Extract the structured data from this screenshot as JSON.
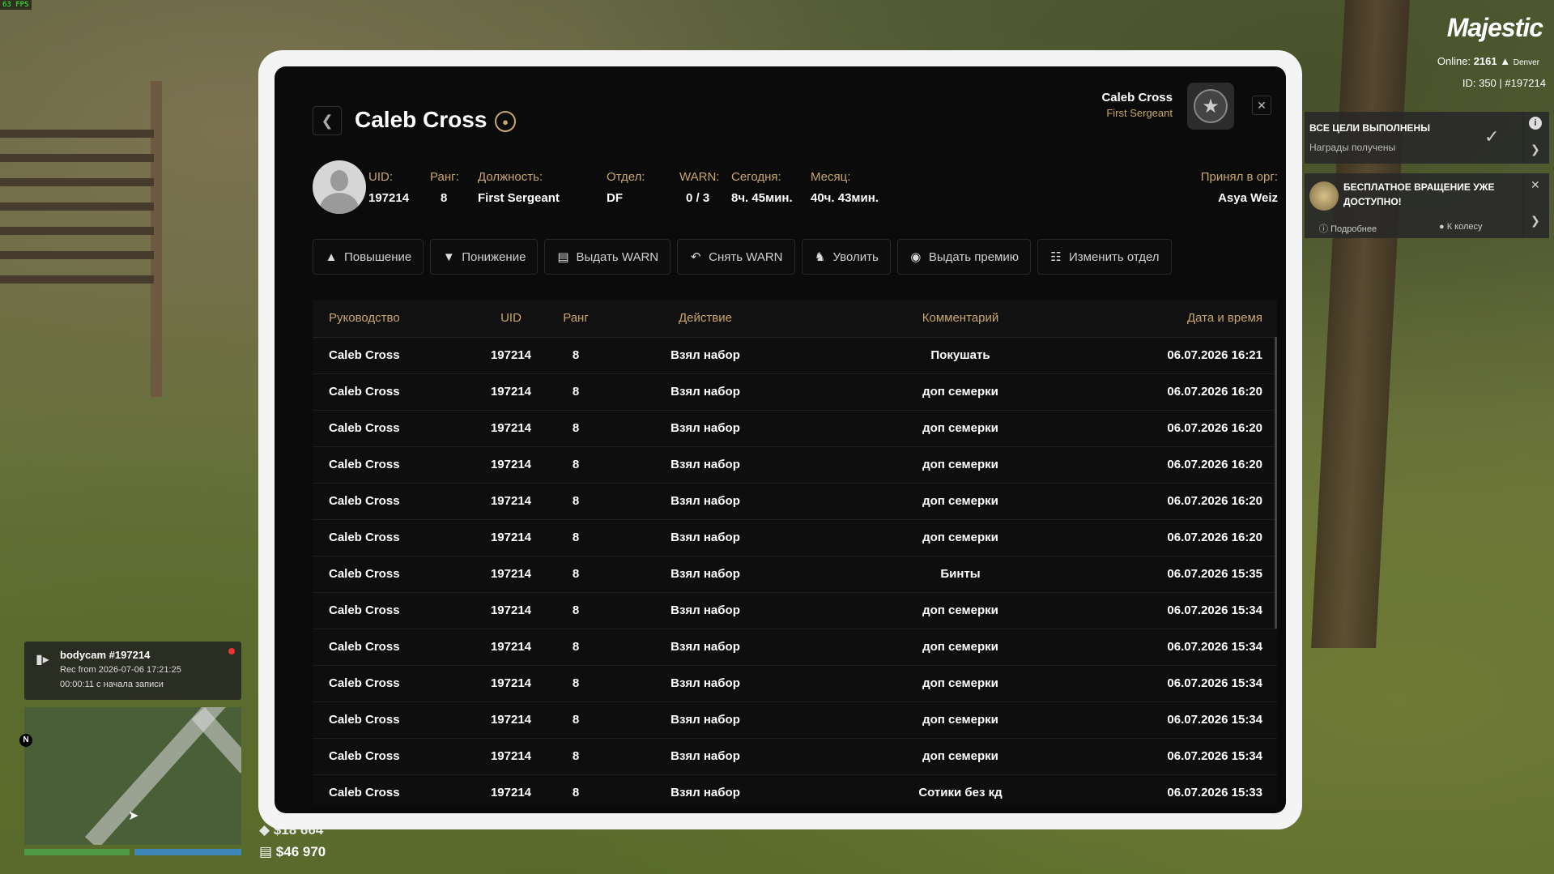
{
  "hud": {
    "fps": "63 FPS",
    "brand": "Majestic",
    "online_label": "Online:",
    "online_count": "2161",
    "server": "Denver",
    "id_line": "ID: 350 | #197214",
    "task_title": "ВСЕ ЦЕЛИ ВЫПОЛНЕНЫ",
    "task_sub": "Награды получены",
    "wheel_text": "БЕСПЛАТНОЕ ВРАЩЕНИЕ УЖЕ ДОСТУПНО!",
    "wheel_more": "Подробнее",
    "wheel_go": "К колесу",
    "bodycam_title": "bodycam #197214",
    "bodycam_rec": "Rec from 2026-07-06 17:21:25",
    "bodycam_time": "00:00:11 с начала записи",
    "compass": "N",
    "cash": "$18 664",
    "bank": "$46 970"
  },
  "tablet": {
    "title": "Caleb Cross",
    "current_user": {
      "name": "Caleb Cross",
      "rank": "First Sergeant"
    },
    "stats": {
      "uid_label": "UID:",
      "uid": "197214",
      "rank_label": "Ранг:",
      "rank": "8",
      "position_label": "Должность:",
      "position": "First Sergeant",
      "dept_label": "Отдел:",
      "dept": "DF",
      "warn_label": "WARN:",
      "warn": "0 / 3",
      "today_label": "Сегодня:",
      "today": "8ч. 45мин.",
      "month_label": "Месяц:",
      "month": "40ч. 43мин.",
      "accepted_label": "Принял в орг:",
      "accepted": "Asya Weiz"
    },
    "actions": [
      {
        "label": "Повышение",
        "icon": "chevron-up-icon"
      },
      {
        "label": "Понижение",
        "icon": "chevron-down-icon"
      },
      {
        "label": "Выдать WARN",
        "icon": "document-warn-icon"
      },
      {
        "label": "Снять WARN",
        "icon": "undo-icon"
      },
      {
        "label": "Уволить",
        "icon": "person-exit-icon"
      },
      {
        "label": "Выдать премию",
        "icon": "coin-icon"
      },
      {
        "label": "Изменить отдел",
        "icon": "org-chart-icon"
      }
    ],
    "table": {
      "headers": [
        "Руководство",
        "UID",
        "Ранг",
        "Действие",
        "Комментарий",
        "Дата и время"
      ],
      "rows": [
        [
          "Caleb Cross",
          "197214",
          "8",
          "Взял набор",
          "Покушать",
          "06.07.2026 16:21"
        ],
        [
          "Caleb Cross",
          "197214",
          "8",
          "Взял набор",
          "доп семерки",
          "06.07.2026 16:20"
        ],
        [
          "Caleb Cross",
          "197214",
          "8",
          "Взял набор",
          "доп семерки",
          "06.07.2026 16:20"
        ],
        [
          "Caleb Cross",
          "197214",
          "8",
          "Взял набор",
          "доп семерки",
          "06.07.2026 16:20"
        ],
        [
          "Caleb Cross",
          "197214",
          "8",
          "Взял набор",
          "доп семерки",
          "06.07.2026 16:20"
        ],
        [
          "Caleb Cross",
          "197214",
          "8",
          "Взял набор",
          "доп семерки",
          "06.07.2026 16:20"
        ],
        [
          "Caleb Cross",
          "197214",
          "8",
          "Взял набор",
          "Бинты",
          "06.07.2026 15:35"
        ],
        [
          "Caleb Cross",
          "197214",
          "8",
          "Взял набор",
          "доп семерки",
          "06.07.2026 15:34"
        ],
        [
          "Caleb Cross",
          "197214",
          "8",
          "Взял набор",
          "доп семерки",
          "06.07.2026 15:34"
        ],
        [
          "Caleb Cross",
          "197214",
          "8",
          "Взял набор",
          "доп семерки",
          "06.07.2026 15:34"
        ],
        [
          "Caleb Cross",
          "197214",
          "8",
          "Взял набор",
          "доп семерки",
          "06.07.2026 15:34"
        ],
        [
          "Caleb Cross",
          "197214",
          "8",
          "Взял набор",
          "доп семерки",
          "06.07.2026 15:34"
        ],
        [
          "Caleb Cross",
          "197214",
          "8",
          "Взял набор",
          "Сотики без кд",
          "06.07.2026 15:33"
        ]
      ]
    }
  }
}
